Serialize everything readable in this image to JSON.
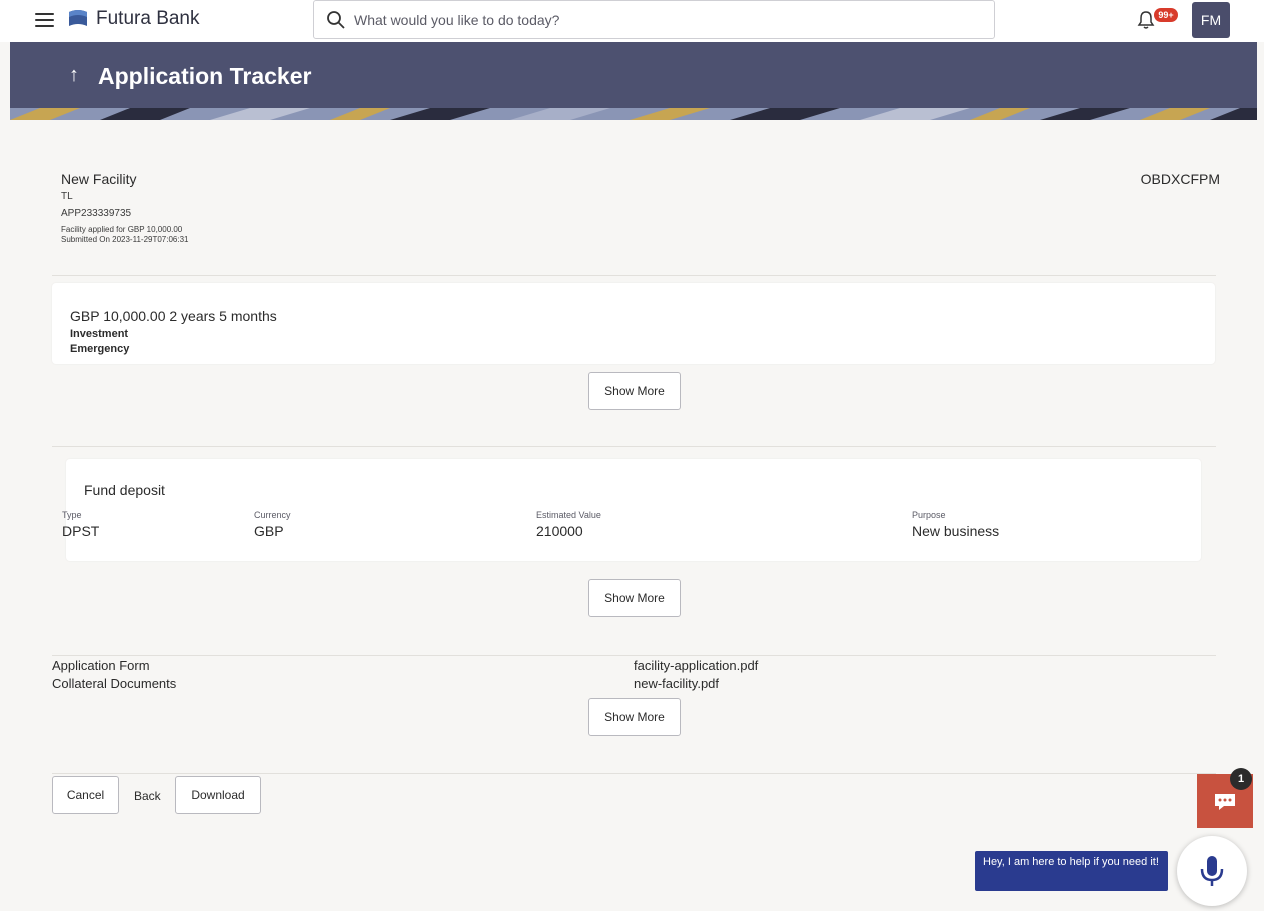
{
  "topbar": {
    "brand": "Futura Bank",
    "search_placeholder": "What would you like to do today?",
    "notification_badge": "99+",
    "user_initials": "FM"
  },
  "header": {
    "title": "Application Tracker"
  },
  "summary": {
    "name": "New Facility",
    "type": "TL",
    "application_id": "APP233339735",
    "applied_text": "Facility applied for GBP 10,000.00",
    "submitted_text": "Submitted On 2023-11-29T07:06:31",
    "party_ref": "OBDXCFPM"
  },
  "loan_card": {
    "amount_tenure": "GBP 10,000.00 2 years 5 months",
    "purposes": [
      "Investment",
      "Emergency"
    ],
    "show_more": "Show More"
  },
  "collateral_card": {
    "title": "Fund deposit",
    "fields": [
      {
        "label": "Type",
        "value": "DPST"
      },
      {
        "label": "Currency",
        "value": "GBP"
      },
      {
        "label": "Estimated Value",
        "value": "210000"
      },
      {
        "label": "Purpose",
        "value": "New business"
      }
    ],
    "show_more": "Show More"
  },
  "documents": {
    "rows": [
      {
        "label": "Application Form",
        "file": "facility-application.pdf"
      },
      {
        "label": "Collateral Documents",
        "file": "new-facility.pdf"
      }
    ],
    "show_more": "Show More"
  },
  "actions": {
    "cancel": "Cancel",
    "back": "Back",
    "download": "Download"
  },
  "chat": {
    "count": "1",
    "assistant_text": "Hey, I am here to help if you need it!"
  },
  "colors": {
    "header_bg": "#4d5170",
    "chat_bg": "#c8523f",
    "assistant_bg": "#2a3b8f",
    "badge": "#d83b2b"
  }
}
